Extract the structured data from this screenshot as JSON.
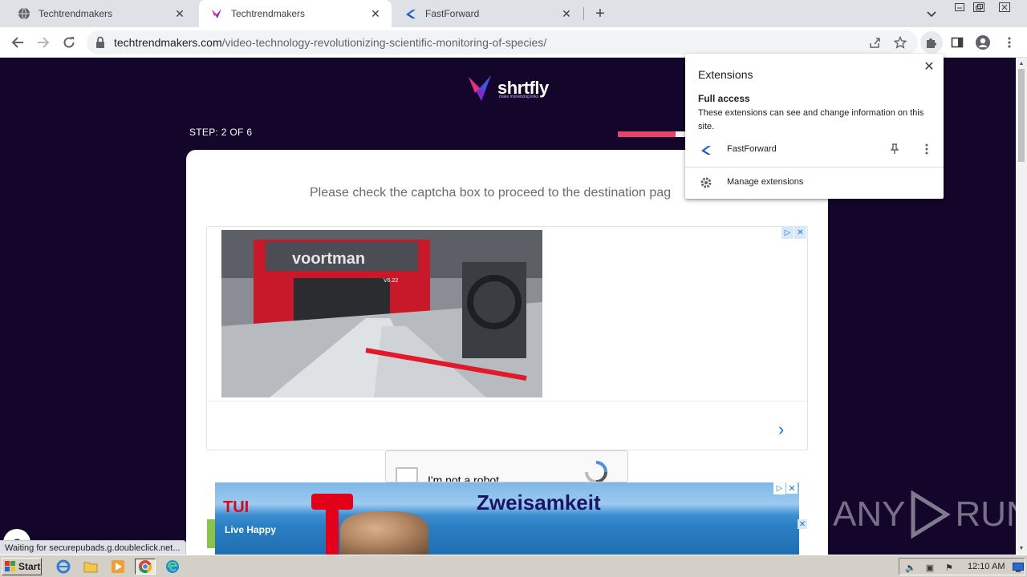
{
  "browser": {
    "tabs": [
      {
        "title": "Techtrendmakers",
        "active": false
      },
      {
        "title": "Techtrendmakers",
        "active": true
      },
      {
        "title": "FastForward",
        "active": false
      }
    ],
    "address": {
      "host": "techtrendmakers.com",
      "path": "/video-technology-revolutionizing-scientific-monitoring-of-species/"
    },
    "status_text": "Waiting for securepubads.g.doubleclick.net..."
  },
  "page": {
    "logo_text": "shrtfly",
    "logo_tagline": "make monetizing links",
    "step_label": "STEP: 2 OF 6",
    "progress_fraction": 0.6,
    "prompt": "Please check the captcha box to proceed to the destination pag",
    "ad1_brand": "voortman",
    "ad1_model": "V6.22",
    "captcha_label": "I'm not a robot",
    "ad2_headline": "Zweisamkeit",
    "ad2_brand": "TUI",
    "ad2_tagline": "Live Happy",
    "float_button": "C"
  },
  "extensions_popup": {
    "title": "Extensions",
    "section_heading": "Full access",
    "section_desc": "These extensions can see and change information on this site.",
    "extension_name": "FastForward",
    "manage_label": "Manage extensions"
  },
  "watermark": {
    "left": "ANY",
    "right": "RUN"
  },
  "taskbar": {
    "start_label": "Start",
    "clock": "12:10 AM"
  },
  "colors": {
    "page_bg": "#14052a",
    "progress_fill": "#e8446a",
    "link_blue": "#1a73e8",
    "ad2_headline": "#1a1464"
  }
}
